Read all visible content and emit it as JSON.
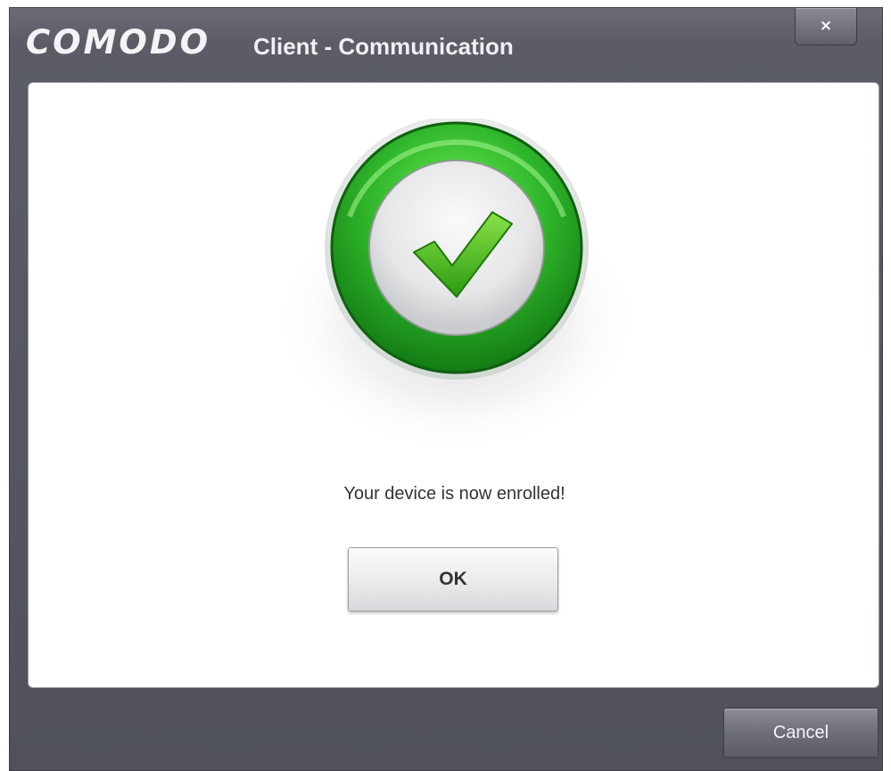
{
  "window": {
    "logo": "COMODO",
    "title": "Client - Communication",
    "close_label": "×"
  },
  "content": {
    "status_icon": "check-icon",
    "message": "Your device is now enrolled!",
    "ok_label": "OK"
  },
  "footer": {
    "cancel_label": "Cancel"
  },
  "colors": {
    "titlebar": "#5b5c66",
    "ring_green": "#2fb52a",
    "check_green": "#3dbb1c",
    "panel": "#ffffff"
  }
}
